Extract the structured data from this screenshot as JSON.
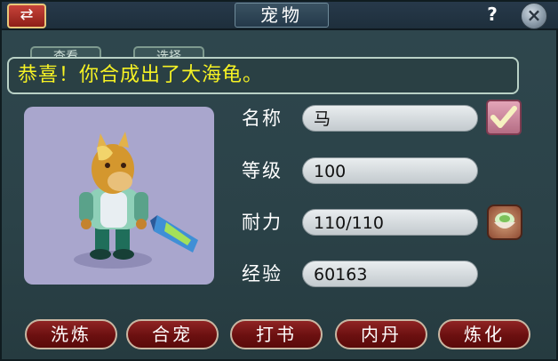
{
  "window": {
    "title": "宠物",
    "switch_symbol": "⇄",
    "help_symbol": "?",
    "close_symbol": "×"
  },
  "hidden_tabs": [
    "查看",
    "选择"
  ],
  "message": "恭喜！你合成出了大海龟。",
  "pet": {
    "fields": [
      {
        "label": "名称",
        "value": "马"
      },
      {
        "label": "等级",
        "value": "100"
      },
      {
        "label": "耐力",
        "value": "110/110"
      },
      {
        "label": "经验",
        "value": "60163"
      }
    ]
  },
  "actions": [
    "洗炼",
    "合宠",
    "打书",
    "内丹",
    "炼化"
  ],
  "colors": {
    "message_text": "#f6f224",
    "action_button": "#7a1818",
    "portrait_bg": "#a9a6cd"
  }
}
